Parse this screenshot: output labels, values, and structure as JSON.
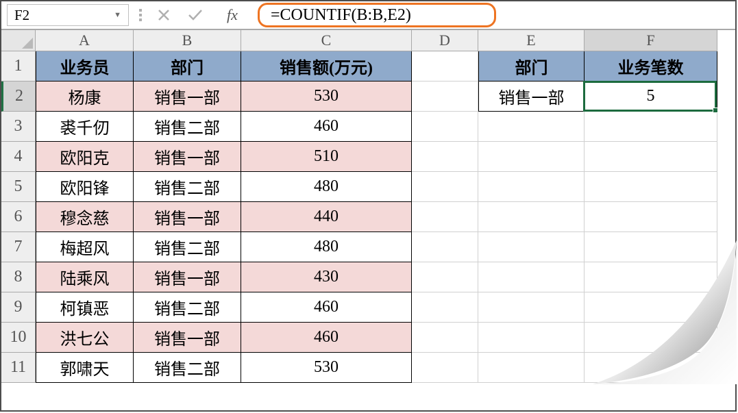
{
  "namebox": "F2",
  "formula": "=COUNTIF(B:B,E2)",
  "fx_label": "fx",
  "columns": [
    "A",
    "B",
    "C",
    "D",
    "E",
    "F"
  ],
  "header_row1": {
    "A": "业务员",
    "B": "部门",
    "C": "销售额(万元)",
    "E": "部门",
    "F": "业务笔数"
  },
  "lookup": {
    "E2": "销售一部",
    "F2": "5"
  },
  "rows": [
    {
      "r": "2",
      "A": "杨康",
      "B": "销售一部",
      "C": "530",
      "pink": true
    },
    {
      "r": "3",
      "A": "裘千仞",
      "B": "销售二部",
      "C": "460",
      "pink": false
    },
    {
      "r": "4",
      "A": "欧阳克",
      "B": "销售一部",
      "C": "510",
      "pink": true
    },
    {
      "r": "5",
      "A": "欧阳锋",
      "B": "销售二部",
      "C": "480",
      "pink": false
    },
    {
      "r": "6",
      "A": "穆念慈",
      "B": "销售一部",
      "C": "440",
      "pink": true
    },
    {
      "r": "7",
      "A": "梅超风",
      "B": "销售二部",
      "C": "480",
      "pink": false
    },
    {
      "r": "8",
      "A": "陆乘风",
      "B": "销售一部",
      "C": "430",
      "pink": true
    },
    {
      "r": "9",
      "A": "柯镇恶",
      "B": "销售二部",
      "C": "460",
      "pink": false
    },
    {
      "r": "10",
      "A": "洪七公",
      "B": "销售一部",
      "C": "460",
      "pink": true
    },
    {
      "r": "11",
      "A": "郭啸天",
      "B": "销售二部",
      "C": "530",
      "pink": false
    }
  ],
  "activeRow": "2",
  "activeCol": "F"
}
